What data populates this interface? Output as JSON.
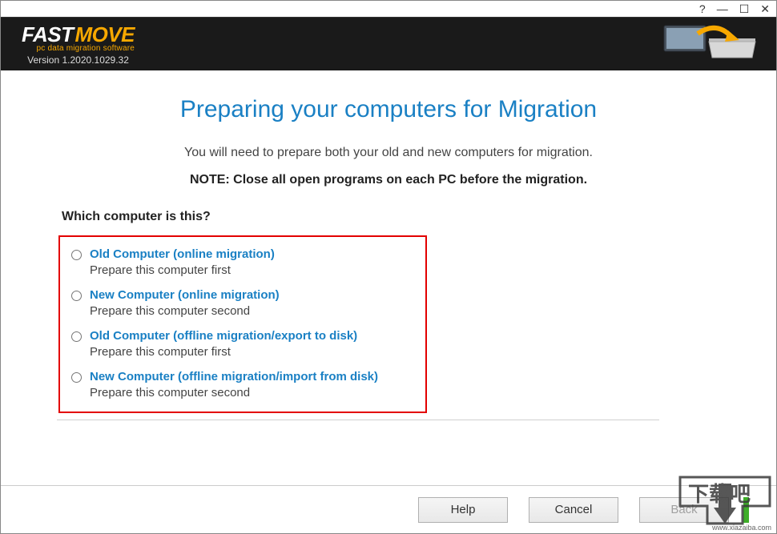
{
  "window": {
    "help_icon": "?",
    "minimize_icon": "—",
    "maximize_icon": "☐",
    "close_icon": "✕"
  },
  "header": {
    "logo_prefix": "FAST",
    "logo_suffix": "MOVE",
    "tagline": "pc data migration software",
    "version": "Version 1.2020.1029.32"
  },
  "page": {
    "title": "Preparing your computers for Migration",
    "intro": "You will need to prepare both your old and new computers for migration.",
    "note": "NOTE: Close all open programs on each PC before the migration.",
    "question": "Which computer is this?"
  },
  "options": [
    {
      "label": "Old Computer (online migration)",
      "desc": "Prepare this computer first"
    },
    {
      "label": "New Computer (online migration)",
      "desc": "Prepare this computer second"
    },
    {
      "label": "Old Computer (offline migration/export to disk)",
      "desc": "Prepare this computer first"
    },
    {
      "label": "New Computer (offline migration/import from disk)",
      "desc": "Prepare this computer second"
    }
  ],
  "footer": {
    "help": "Help",
    "cancel": "Cancel",
    "back": "Back"
  },
  "watermark": {
    "url": "www.xiazaiba.com"
  }
}
